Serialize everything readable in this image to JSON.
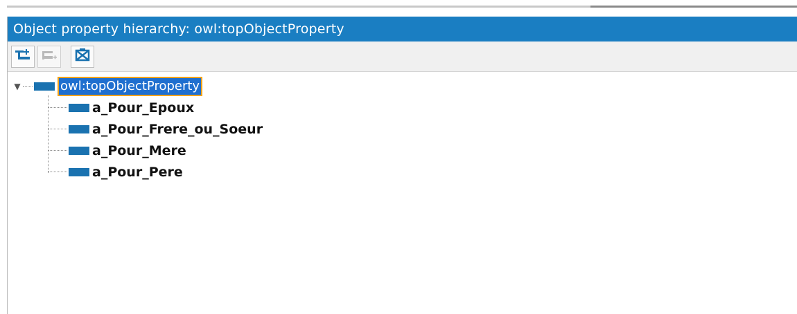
{
  "panel": {
    "title": "Object property hierarchy: owl:topObjectProperty"
  },
  "toolbar": {
    "buttons": [
      {
        "name": "add-sub-property",
        "icon": "add-subproperty-icon",
        "enabled": true
      },
      {
        "name": "add-sibling-property",
        "icon": "add-sibling-icon",
        "enabled": false
      },
      {
        "name": "delete-property",
        "icon": "delete-icon",
        "enabled": true
      }
    ]
  },
  "tree": {
    "root": {
      "label": "owl:topObjectProperty",
      "expanded": true,
      "selected": true
    },
    "children": [
      {
        "label": "a_Pour_Epoux"
      },
      {
        "label": "a_Pour_Frere_ou_Soeur"
      },
      {
        "label": "a_Pour_Mere"
      },
      {
        "label": "a_Pour_Pere"
      }
    ]
  },
  "colors": {
    "title_bar": "#1a7ec2",
    "property_icon": "#1a72b0",
    "selection_bg": "#1f6fcf",
    "selection_border": "#f2a31b"
  }
}
